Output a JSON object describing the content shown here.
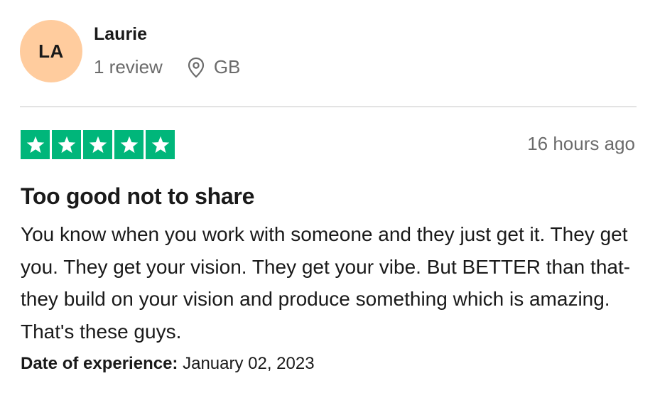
{
  "consumer": {
    "initials": "LA",
    "name": "Laurie",
    "review_count": "1 review",
    "location_icon": "location-pin-icon",
    "country": "GB"
  },
  "review": {
    "rating": 5,
    "rating_max": 5,
    "star_color": "#00b67a",
    "timestamp": "16 hours ago",
    "title": "Too good not to share",
    "body": "You know when you work with someone and they just get it. They get you. They get your vision. They get your vibe. But BETTER than that- they build on your vision and produce something which is amazing. That's these guys.",
    "experience_label": "Date of experience:",
    "experience_date": "January 02, 2023"
  },
  "colors": {
    "avatar_bg": "#ffcc9e",
    "muted_text": "#6b6b6b",
    "divider": "#e3e3e3"
  }
}
